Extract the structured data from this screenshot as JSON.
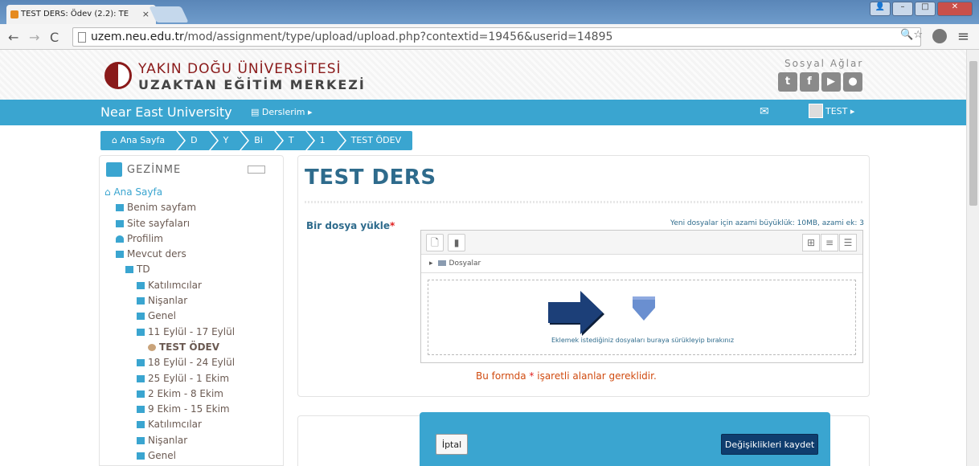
{
  "browser": {
    "tab_title": "TEST DERS: Ödev (2.2): TE",
    "tab_close": "×",
    "url_domain": "uzem.neu.edu.tr",
    "url_path": "/mod/assignment/type/upload/upload.php?contextid=19456&userid=14895"
  },
  "site": {
    "logo_line1": "YAKIN DOĞU ÜNİVERSİTESİ",
    "logo_line2": "UZAKTAN EĞİTİM MERKEZİ",
    "social_title": "Sosyal Ağlar",
    "social_icons": [
      "twitter-icon",
      "facebook-icon",
      "youtube-icon",
      "blog-icon"
    ]
  },
  "navbar": {
    "brand": "Near East University",
    "courses": "Derslerim",
    "user": "TEST"
  },
  "breadcrumb": [
    "Ana Sayfa",
    "D",
    "Y",
    "Bi",
    "T",
    "1",
    "TEST ÖDEV"
  ],
  "navigation": {
    "title": "GEZİNME",
    "items": [
      {
        "label": "Ana Sayfa",
        "icon": "home-icon"
      },
      {
        "label": "Benim sayfam",
        "icon": "page-icon"
      },
      {
        "label": "Site sayfaları",
        "icon": "folder-icon"
      },
      {
        "label": "Profilim",
        "icon": "user-icon"
      },
      {
        "label": "Mevcut ders",
        "icon": "folder-open-icon"
      },
      {
        "label": "TD",
        "icon": "folder-open-icon"
      },
      {
        "label": "Katılımcılar",
        "icon": "folder-icon"
      },
      {
        "label": "Nişanlar",
        "icon": "folder-icon"
      },
      {
        "label": "Genel",
        "icon": "folder-icon"
      },
      {
        "label": "11 Eylül - 17 Eylül",
        "icon": "folder-open-icon"
      },
      {
        "label": "TEST ÖDEV",
        "icon": "assignment-icon"
      },
      {
        "label": "18 Eylül - 24 Eylül",
        "icon": "folder-icon"
      },
      {
        "label": "25 Eylül - 1 Ekim",
        "icon": "folder-icon"
      },
      {
        "label": "2 Ekim - 8 Ekim",
        "icon": "folder-icon"
      },
      {
        "label": "9 Ekim - 15 Ekim",
        "icon": "folder-icon"
      },
      {
        "label": "Katılımcılar",
        "icon": "folder-icon"
      },
      {
        "label": "Nişanlar",
        "icon": "folder-icon"
      },
      {
        "label": "Genel",
        "icon": "folder-icon"
      }
    ]
  },
  "main": {
    "title": "TEST DERS",
    "field_label": "Bir dosya yükle",
    "required_mark": "*",
    "max_size": "Yeni dosyalar için azami büyüklük: 10MB, azami ek: 3",
    "folder_path": "Dosyalar",
    "drop_text": "Eklemek istediğiniz dosyaları buraya sürükleyip bırakınız",
    "required_note_pre": "Bu formda ",
    "required_note_post": " işaretli alanlar gereklidir."
  },
  "actions": {
    "cancel": "İptal",
    "save": "Değişiklikleri kaydet"
  },
  "colors": {
    "accent": "#3aa5d0",
    "title": "#2e6b8c",
    "brand_red": "#8a1a1a",
    "save_button": "#0f3d6e"
  }
}
